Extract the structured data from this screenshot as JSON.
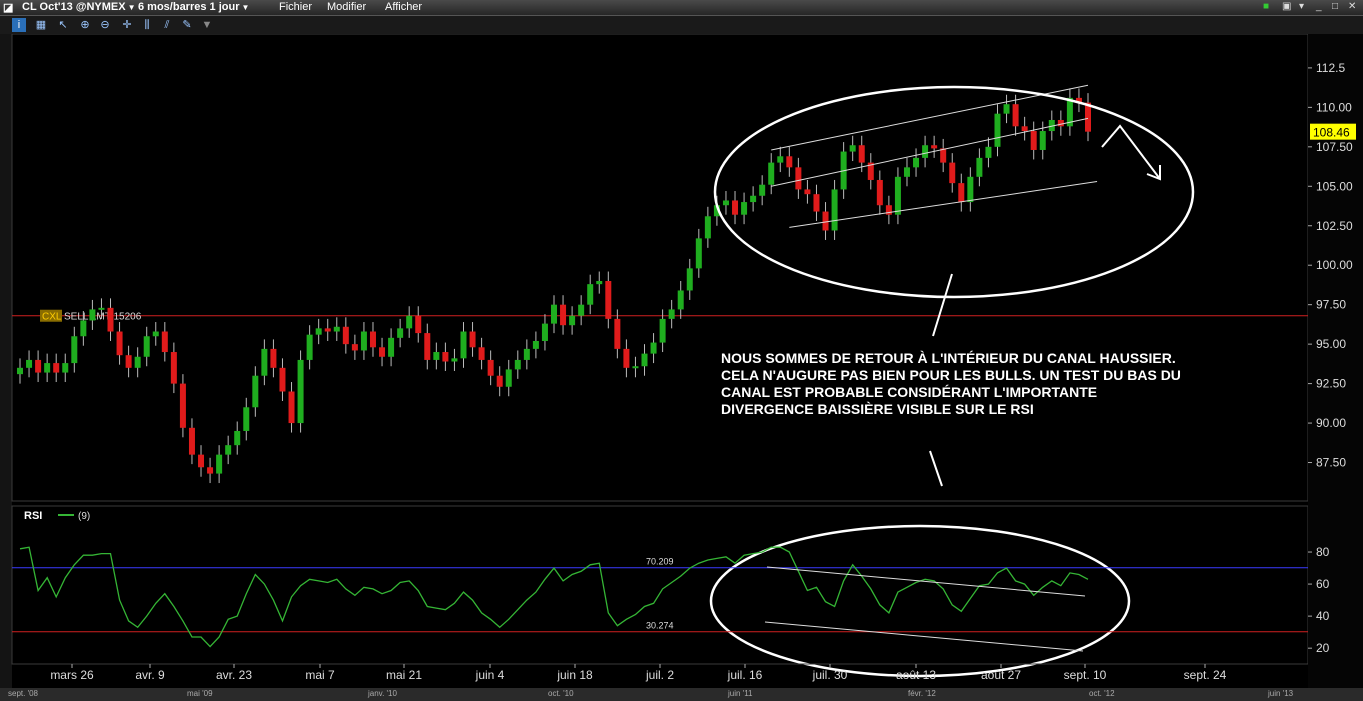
{
  "window": {
    "symbol": "CL Oct'13 @NYMEX",
    "timeframe": "6 mos/barres 1 jour",
    "menus": [
      "Fichier",
      "Modifier",
      "Afficher"
    ],
    "buttons": [
      "green-square-icon",
      "settings-icon",
      "minimize-icon",
      "maximize-icon",
      "close-icon"
    ]
  },
  "colors": {
    "background": "#000000",
    "up_candle": "#1fae1f",
    "down_candle": "#e01b1b",
    "price_tag": "#ffff00",
    "rsi_line": "#35b535",
    "rsi_upper_line": "#3a3aff",
    "rsi_lower_line": "#d02020",
    "order_line": "#d02020",
    "drawings": "#ffffff"
  },
  "order": {
    "cancel_label": "CXL",
    "label": "SELL LMT 15206"
  },
  "annotation": "NOUS SOMMES DE RETOUR À L'INTÉRIEUR DU CANAL HAUSSIER. CELA N'AUGURE PAS BIEN POUR LES BULLS. UN TEST DU BAS DU CANAL EST PROBABLE CONSIDÉRANT L'IMPORTANTE DIVERGENCE BAISSIÈRE VISIBLE SUR LE RSI",
  "rsi_panel": {
    "label": "RSI",
    "param": "(9)",
    "upper_label": "70.209",
    "lower_label": "30.274"
  },
  "bottom_strip": [
    "sept. '08",
    "mai '09",
    "janv. '10",
    "oct. '10",
    "juin '11",
    "févr. '12",
    "oct. '12",
    "juin '13"
  ],
  "chart_data": [
    {
      "type": "candlestick",
      "title": "",
      "last_price": "108.46",
      "order_level": 96.8,
      "ylim": [
        85,
        113
      ],
      "y_ticks": [
        "112.5",
        "110.00",
        "107.50",
        "105.00",
        "102.50",
        "100.00",
        "97.50",
        "95.00",
        "92.50",
        "90.00",
        "87.50"
      ],
      "x_ticks": [
        "mars 26",
        "avr. 9",
        "avr. 23",
        "mai 7",
        "mai 21",
        "juin 4",
        "juin 18",
        "juil. 2",
        "juil. 16",
        "juil. 30",
        "août 13",
        "août 27",
        "sept. 10",
        "sept. 24"
      ],
      "close": [
        93.5,
        94.0,
        93.2,
        93.8,
        93.2,
        93.8,
        95.5,
        96.5,
        97.2,
        97.3,
        95.8,
        94.3,
        93.5,
        94.2,
        95.5,
        95.8,
        94.5,
        92.5,
        89.7,
        88.0,
        87.2,
        86.8,
        88.0,
        88.6,
        89.5,
        91.0,
        93.0,
        94.7,
        93.5,
        92.0,
        90.0,
        94.0,
        95.6,
        96.0,
        95.8,
        96.1,
        95.0,
        94.6,
        95.8,
        94.8,
        94.2,
        95.4,
        96.0,
        96.8,
        95.7,
        94.0,
        94.5,
        93.9,
        94.1,
        95.8,
        94.8,
        94.0,
        93.0,
        92.3,
        93.4,
        94.0,
        94.7,
        95.2,
        96.3,
        97.5,
        96.2,
        96.8,
        97.5,
        98.8,
        99.0,
        96.6,
        94.7,
        93.5,
        93.6,
        94.4,
        95.1,
        96.6,
        97.2,
        98.4,
        99.8,
        101.7,
        103.1,
        103.8,
        104.1,
        103.2,
        104.0,
        104.4,
        105.1,
        106.5,
        106.9,
        106.2,
        104.8,
        104.5,
        103.4,
        102.2,
        104.8,
        107.2,
        107.6,
        106.5,
        105.4,
        103.8,
        103.2,
        105.6,
        106.2,
        106.8,
        107.6,
        107.4,
        106.5,
        105.2,
        104.0,
        105.6,
        106.8,
        107.5,
        109.6,
        110.2,
        108.8,
        108.5,
        107.3,
        108.5,
        109.2,
        108.8,
        110.6,
        110.3,
        108.46
      ]
    },
    {
      "type": "line",
      "title": "RSI (9)",
      "ylim": [
        12,
        90
      ],
      "y_ticks": [
        "80",
        "60",
        "40",
        "20"
      ],
      "upper": 70.209,
      "lower": 30.274,
      "values": [
        82,
        83,
        56,
        64,
        52,
        64,
        72,
        78,
        78,
        79,
        79,
        50,
        37,
        33,
        40,
        48,
        54,
        46,
        37,
        27,
        27,
        21,
        27,
        38,
        40,
        54,
        66,
        60,
        50,
        37,
        52,
        59,
        63,
        62,
        61,
        63,
        57,
        53,
        58,
        57,
        54,
        56,
        61,
        62,
        56,
        46,
        45,
        44,
        48,
        55,
        50,
        42,
        38,
        33,
        38,
        44,
        50,
        55,
        63,
        70,
        62,
        66,
        68,
        72,
        73,
        42,
        34,
        38,
        41,
        46,
        48,
        57,
        61,
        65,
        70,
        73,
        75,
        76,
        77,
        73,
        78,
        79,
        80,
        83,
        83,
        80,
        68,
        56,
        58,
        49,
        46,
        62,
        72,
        65,
        57,
        47,
        42,
        55,
        58,
        61,
        63,
        62,
        57,
        47,
        43,
        51,
        59,
        60,
        67,
        70,
        62,
        60,
        53,
        58,
        62,
        59,
        67,
        66,
        63
      ]
    }
  ]
}
